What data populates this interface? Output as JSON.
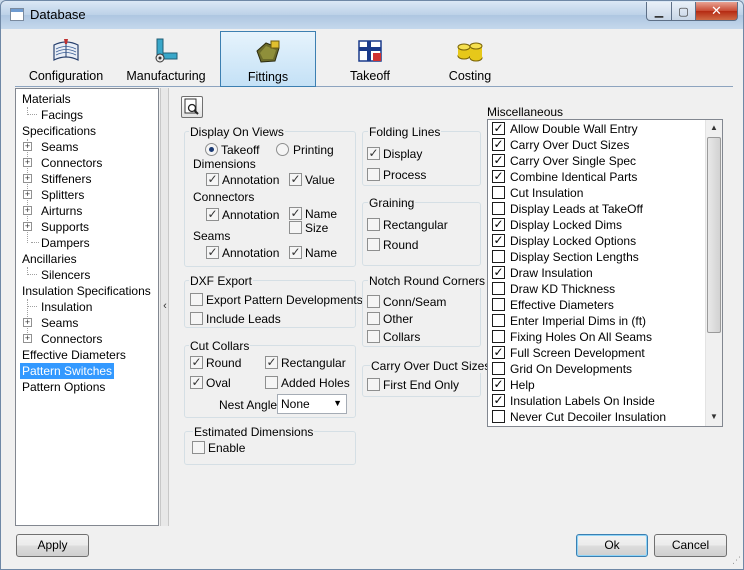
{
  "window": {
    "title": "Database"
  },
  "tabs": [
    {
      "label": "Configuration",
      "icon": "book-icon"
    },
    {
      "label": "Manufacturing",
      "icon": "machine-icon"
    },
    {
      "label": "Fittings",
      "icon": "fitting-icon"
    },
    {
      "label": "Takeoff",
      "icon": "takeoff-icon"
    },
    {
      "label": "Costing",
      "icon": "coins-icon"
    }
  ],
  "tree": {
    "materials": "Materials",
    "facings": "Facings",
    "specifications": "Specifications",
    "seams": "Seams",
    "connectors": "Connectors",
    "stiffeners": "Stiffeners",
    "splitters": "Splitters",
    "airturns": "Airturns",
    "supports": "Supports",
    "dampers": "Dampers",
    "ancillaries": "Ancillaries",
    "silencers": "Silencers",
    "insulation_specifications": "Insulation Specifications",
    "insulation": "Insulation",
    "ins_seams": "Seams",
    "ins_connectors": "Connectors",
    "effective_diameters": "Effective Diameters",
    "pattern_switches": "Pattern Switches",
    "pattern_options": "Pattern Options"
  },
  "display_on_views": {
    "title": "Display On Views",
    "takeoff": "Takeoff",
    "printing": "Printing",
    "dimensions": "Dimensions",
    "dim_annotation": "Annotation",
    "dim_value": "Value",
    "connectors": "Connectors",
    "conn_annotation": "Annotation",
    "conn_name": "Name",
    "conn_size": "Size",
    "seams": "Seams",
    "seam_annotation": "Annotation",
    "seam_name": "Name"
  },
  "folding_lines": {
    "title": "Folding Lines",
    "display": "Display",
    "process": "Process"
  },
  "graining": {
    "title": "Graining",
    "rectangular": "Rectangular",
    "round": "Round"
  },
  "dxf_export": {
    "title": "DXF Export",
    "export_pattern": "Export Pattern Developments",
    "include_leads": "Include Leads"
  },
  "notch_round_corners": {
    "title": "Notch Round Corners",
    "conn_seam": "Conn/Seam",
    "other": "Other",
    "collars": "Collars"
  },
  "cut_collars": {
    "title": "Cut Collars",
    "round": "Round",
    "rectangular": "Rectangular",
    "oval": "Oval",
    "added_holes": "Added Holes",
    "nest_angle": "Nest Angle",
    "nest_value": "None"
  },
  "carry_over_duct_sizes": {
    "title": "Carry Over Duct Sizes",
    "first_end_only": "First End Only"
  },
  "estimated_dimensions": {
    "title": "Estimated Dimensions",
    "enable": "Enable"
  },
  "miscellaneous": {
    "title": "Miscellaneous",
    "items": [
      {
        "label": "Allow Double Wall Entry",
        "checked": true
      },
      {
        "label": "Carry Over Duct Sizes",
        "checked": true
      },
      {
        "label": "Carry Over Single Spec",
        "checked": true
      },
      {
        "label": "Combine Identical Parts",
        "checked": true
      },
      {
        "label": "Cut Insulation",
        "checked": false
      },
      {
        "label": "Display Leads at TakeOff",
        "checked": false
      },
      {
        "label": "Display Locked Dims",
        "checked": true
      },
      {
        "label": "Display Locked Options",
        "checked": true
      },
      {
        "label": "Display Section Lengths",
        "checked": false
      },
      {
        "label": "Draw Insulation",
        "checked": true
      },
      {
        "label": "Draw KD Thickness",
        "checked": false
      },
      {
        "label": "Effective Diameters",
        "checked": false
      },
      {
        "label": "Enter Imperial Dims in (ft)",
        "checked": false
      },
      {
        "label": "Fixing Holes On All Seams",
        "checked": false
      },
      {
        "label": "Full Screen Development",
        "checked": true
      },
      {
        "label": "Grid On Developments",
        "checked": false
      },
      {
        "label": "Help",
        "checked": true
      },
      {
        "label": "Insulation Labels On Inside",
        "checked": true
      },
      {
        "label": "Never Cut Decoiler Insulation",
        "checked": false
      }
    ]
  },
  "footer": {
    "apply": "Apply",
    "ok": "Ok",
    "cancel": "Cancel"
  }
}
